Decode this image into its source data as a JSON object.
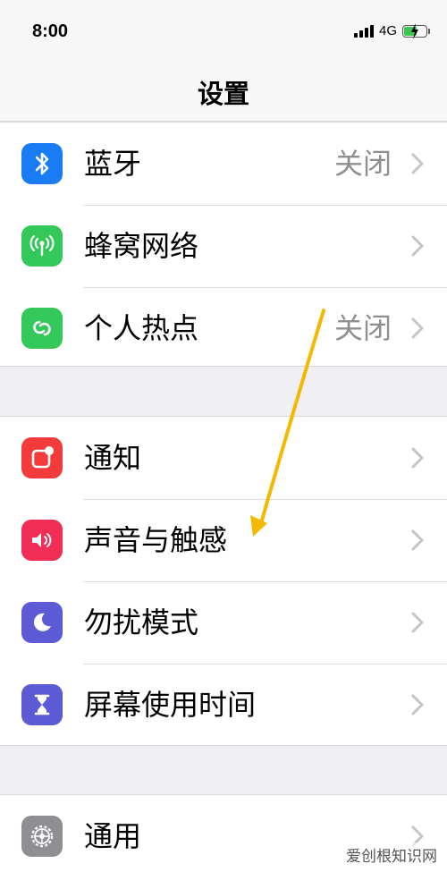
{
  "status_bar": {
    "time": "8:00",
    "network": "4G"
  },
  "nav": {
    "title": "设置"
  },
  "groups": [
    {
      "items": [
        {
          "label": "蓝牙",
          "detail": "关闭",
          "icon": "bluetooth-icon",
          "color": "#1a7cf5"
        },
        {
          "label": "蜂窝网络",
          "detail": "",
          "icon": "cellular-antenna-icon",
          "color": "#34c759"
        },
        {
          "label": "个人热点",
          "detail": "关闭",
          "icon": "hotspot-link-icon",
          "color": "#34c759"
        }
      ]
    },
    {
      "items": [
        {
          "label": "通知",
          "detail": "",
          "icon": "notification-icon",
          "color": "#f23b3a"
        },
        {
          "label": "声音与触感",
          "detail": "",
          "icon": "speaker-icon",
          "color": "#f02d55"
        },
        {
          "label": "勿扰模式",
          "detail": "",
          "icon": "moon-icon",
          "color": "#5d5ad6"
        },
        {
          "label": "屏幕使用时间",
          "detail": "",
          "icon": "hourglass-icon",
          "color": "#5d5ad6"
        }
      ]
    },
    {
      "items": [
        {
          "label": "通用",
          "detail": "",
          "icon": "gear-icon",
          "color": "#8e8e93"
        }
      ]
    }
  ],
  "annotation": {
    "arrow_color": "#f5b800"
  },
  "watermark": {
    "text": "爱创根知识网"
  }
}
